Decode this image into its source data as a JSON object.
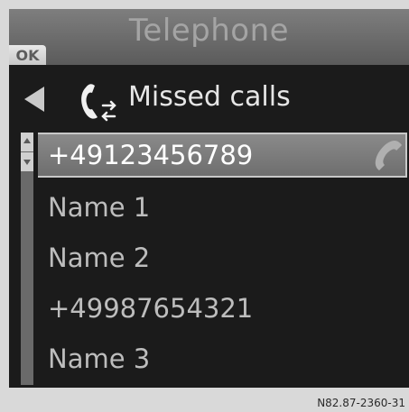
{
  "title_bar": {
    "title": "Telephone",
    "ok_label": "OK"
  },
  "header": {
    "label": "Missed calls"
  },
  "list": {
    "items": [
      {
        "label": "+49123456789",
        "selected": true
      },
      {
        "label": "Name 1",
        "selected": false
      },
      {
        "label": "Name 2",
        "selected": false
      },
      {
        "label": "+49987654321",
        "selected": false
      },
      {
        "label": "Name 3",
        "selected": false
      }
    ]
  },
  "figure_code": "N82.87-2360-31",
  "icons": {
    "back": "back-arrow-icon",
    "header": "missed-calls-icon",
    "call": "phone-handset-icon",
    "scroll_up": "scroll-up-icon",
    "scroll_down": "scroll-down-icon"
  },
  "colors": {
    "background": "#1b1b1b",
    "title_bar": "#6b6b6b",
    "selected_row": "#7c7c7c",
    "text": "#bdbdbd"
  }
}
